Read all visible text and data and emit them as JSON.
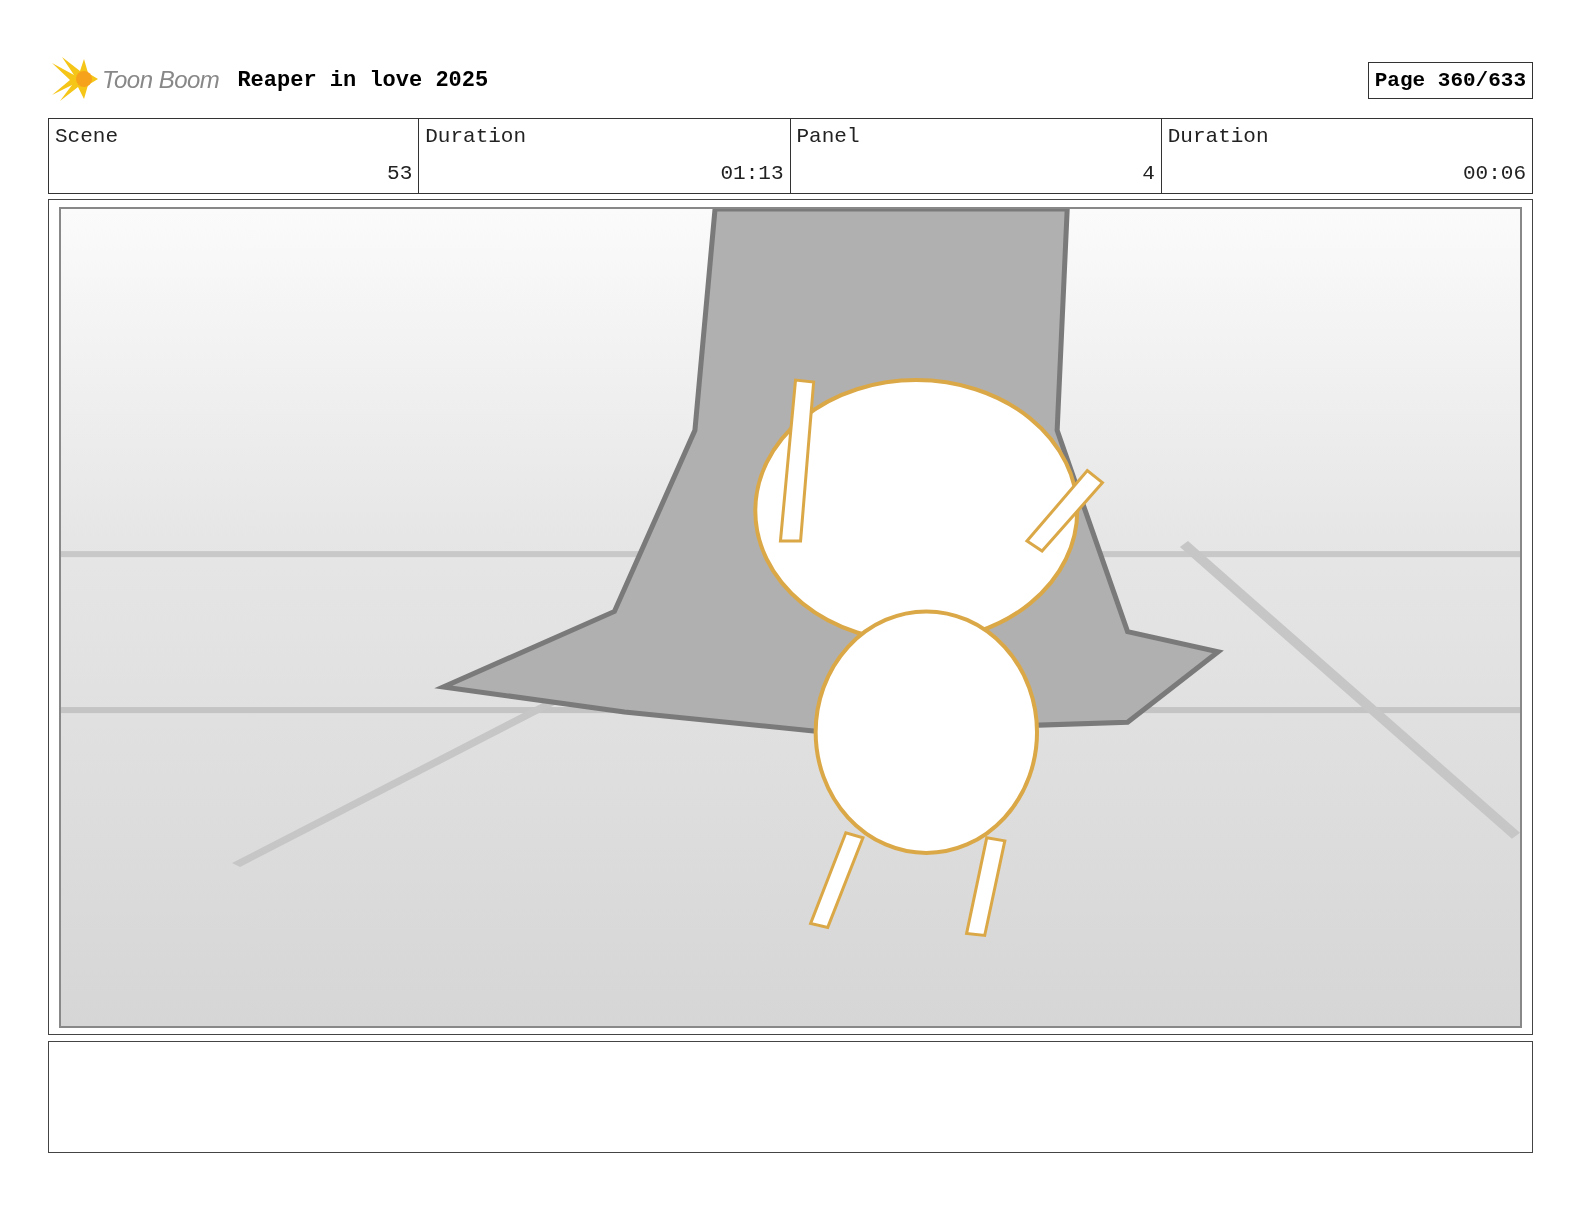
{
  "header": {
    "logo_text": "Toon Boom",
    "title": "Reaper in love 2025",
    "page": "Page 360/633"
  },
  "info": {
    "columns": [
      "Scene",
      "Duration",
      "Panel",
      "Duration"
    ],
    "row": [
      "53",
      "01:13",
      "4",
      "00:06"
    ]
  }
}
